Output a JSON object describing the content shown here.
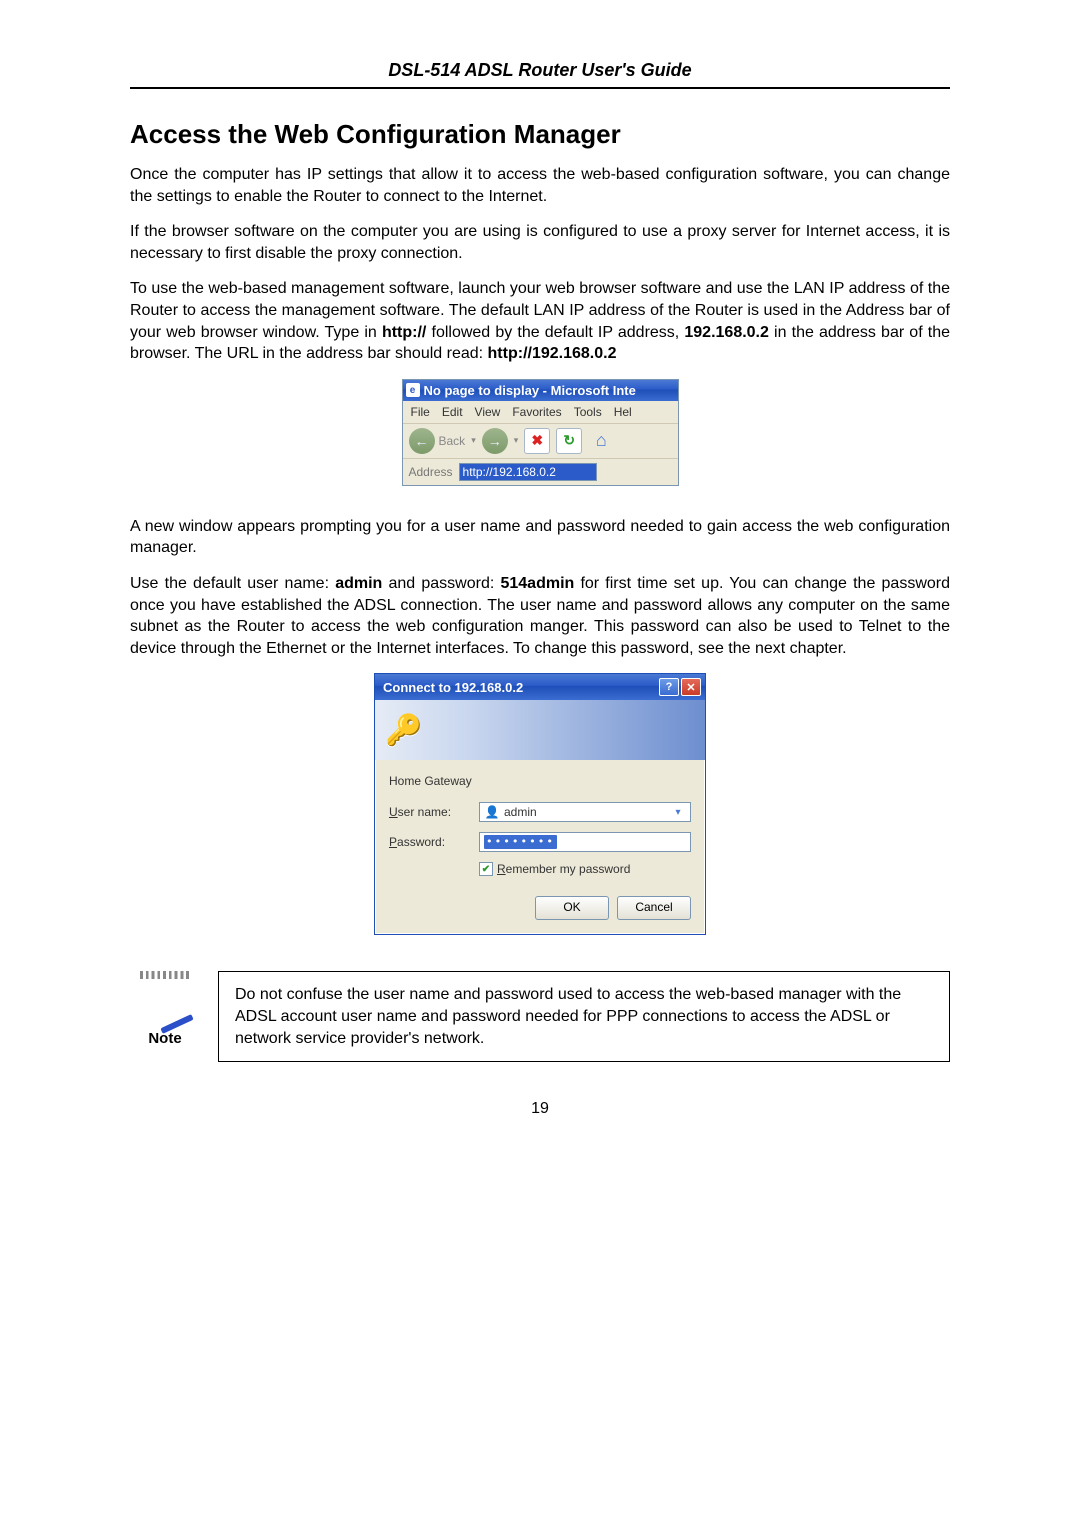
{
  "doc_header": "DSL-514 ADSL Router User's Guide",
  "section_title": "Access the Web Configuration Manager",
  "para1": "Once the computer has IP settings that allow it to access the web-based configuration software, you can change the settings to enable the Router to connect to the Internet.",
  "para2": "If the browser software on the computer you are using is configured to use a proxy server for Internet access, it is necessary to first disable the proxy connection.",
  "para3_part1": "To use the web-based management software, launch your web browser software and use the LAN IP address of the Router to access the management software. The default LAN IP address of the Router is used in the Address bar of your web browser window. Type in ",
  "para3_bold1": "http://",
  "para3_part2": " followed by the default IP address, ",
  "para3_bold2": "192.168.0.2",
  "para3_part3": " in the address bar of the browser. The URL in the address bar should read: ",
  "para3_bold3": "http://192.168.0.2",
  "ie": {
    "title": "No page to display - Microsoft Inte",
    "menus": [
      "File",
      "Edit",
      "View",
      "Favorites",
      "Tools",
      "Hel"
    ],
    "back_label": "Back",
    "addr_label": "Address",
    "addr_value": "http://192.168.0.2"
  },
  "para4": "A new window appears prompting you for a user name and password needed to gain access the web configuration manager.",
  "para5_part1": "Use the default user name: ",
  "para5_bold1": "admin",
  "para5_part2": " and password: ",
  "para5_bold2": "514admin",
  "para5_part3": " for first time set up. You can change the password once you have established the ADSL connection. The user name and password allows any computer on the same subnet as the Router to access the web configuration manger. This password can also be used to Telnet to the device through the Ethernet or the Internet interfaces. To change this password, see the next chapter.",
  "login": {
    "title": "Connect to 192.168.0.2",
    "realm": "Home Gateway",
    "user_label_pre": "U",
    "user_label_post": "ser name:",
    "user_value": "admin",
    "pass_label_pre": "P",
    "pass_label_post": "assword:",
    "pass_mask": "••••••••",
    "remember_pre": "R",
    "remember_post": "emember my password",
    "ok": "OK",
    "cancel": "Cancel"
  },
  "note_label": "Note",
  "note_text": "Do not confuse the user name and password used to access the web-based manager with the ADSL account user name and password needed for PPP connections to access the ADSL or network service provider's network.",
  "page_number": "19"
}
